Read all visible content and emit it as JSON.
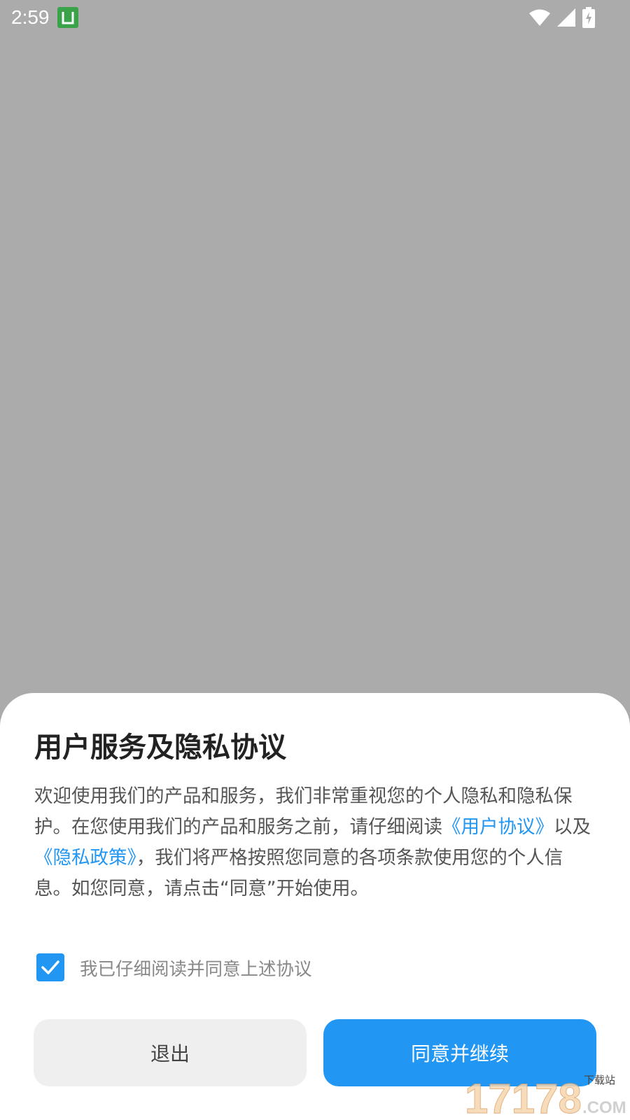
{
  "status_bar": {
    "time": "2:59",
    "notification_icon": "app-notification-icon",
    "icons": [
      "wifi-icon",
      "signal-icon",
      "battery-charging-icon"
    ]
  },
  "dialog": {
    "title": "用户服务及隐私协议",
    "body": {
      "part1": "欢迎使用我们的产品和服务，我们非常重视您的个人隐私和隐私保护。在您使用我们的产品和服务之前，请仔细阅读",
      "user_agreement_link": "《用户协议》",
      "part2": "以及",
      "privacy_policy_link": "《隐私政策》",
      "part3": "，我们将严格按照您同意的各项条款使用您的个人信息。如您同意，请点击“同意”开始使用。"
    },
    "agree_checkbox": {
      "label": "我已仔细阅读并同意上述协议",
      "checked": true
    },
    "exit_button": "退出",
    "agree_button": "同意并继续"
  },
  "colors": {
    "accent": "#2196f3",
    "overlay": "#ababab"
  }
}
